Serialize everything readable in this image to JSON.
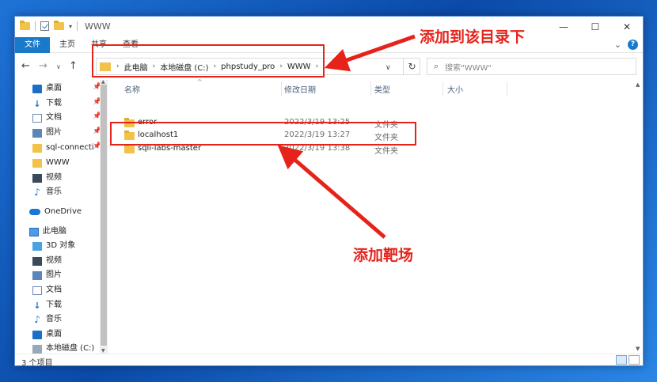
{
  "window": {
    "title": "WWW",
    "controls": {
      "minimize": "—",
      "maximize": "☐",
      "close": "✕"
    }
  },
  "ribbon": {
    "tabs": [
      "文件",
      "主页",
      "共享",
      "查看"
    ],
    "expand": "⌄",
    "help": "?"
  },
  "address": {
    "crumbs": [
      "此电脑",
      "本地磁盘 (C:)",
      "phpstudy_pro",
      "WWW"
    ],
    "chevron": "›"
  },
  "search": {
    "placeholder": "搜索\"WWW\""
  },
  "nav": {
    "quick_access": [
      {
        "label": "桌面",
        "icon": "desktop-icon",
        "pinned": true
      },
      {
        "label": "下载",
        "icon": "download-icon",
        "pinned": true
      },
      {
        "label": "文档",
        "icon": "document-icon",
        "pinned": true
      },
      {
        "label": "图片",
        "icon": "picture-icon",
        "pinned": true
      },
      {
        "label": "sql-connecti",
        "icon": "folder-icon",
        "pinned": true
      },
      {
        "label": "WWW",
        "icon": "folder-icon",
        "pinned": false
      },
      {
        "label": "视频",
        "icon": "video-icon",
        "pinned": false
      },
      {
        "label": "音乐",
        "icon": "music-icon",
        "pinned": false
      }
    ],
    "onedrive": "OneDrive",
    "this_pc": "此电脑",
    "this_pc_items": [
      {
        "label": "3D 对象",
        "icon": "3d-objects-icon"
      },
      {
        "label": "视频",
        "icon": "video-icon"
      },
      {
        "label": "图片",
        "icon": "picture-icon"
      },
      {
        "label": "文档",
        "icon": "document-icon"
      },
      {
        "label": "下载",
        "icon": "download-icon"
      },
      {
        "label": "音乐",
        "icon": "music-icon"
      },
      {
        "label": "桌面",
        "icon": "desktop-icon"
      },
      {
        "label": "本地磁盘 (C:)",
        "icon": "disk-icon"
      }
    ]
  },
  "columns": {
    "name": "名称",
    "date": "修改日期",
    "type": "类型",
    "size": "大小"
  },
  "files": [
    {
      "name": "error",
      "date": "2022/3/19 13:25",
      "type": "文件夹"
    },
    {
      "name": "localhost1",
      "date": "2022/3/19 13:27",
      "type": "文件夹"
    },
    {
      "name": "sqli-labs-master",
      "date": "2022/3/19 13:38",
      "type": "文件夹"
    }
  ],
  "status": {
    "count": "3 个项目"
  },
  "annotations": {
    "top": "添加到该目录下",
    "bottom": "添加靶场",
    "color": "#e5231b"
  }
}
